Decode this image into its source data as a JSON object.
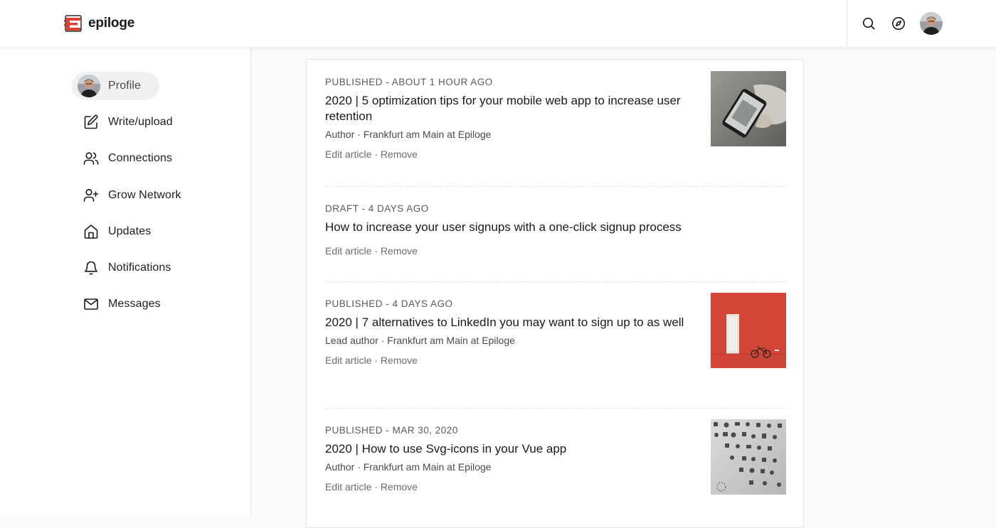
{
  "app": {
    "brand": "epiloge"
  },
  "topbar": {
    "icons": [
      "search-icon",
      "compass-icon"
    ]
  },
  "sidebar": {
    "items": [
      {
        "label": "Profile",
        "icon": "avatar"
      },
      {
        "label": "Write/upload",
        "icon": "edit-icon"
      },
      {
        "label": "Connections",
        "icon": "users-icon"
      },
      {
        "label": "Grow Network",
        "icon": "user-plus-icon"
      },
      {
        "label": "Updates",
        "icon": "home-icon"
      },
      {
        "label": "Notifications",
        "icon": "bell-icon"
      },
      {
        "label": "Messages",
        "icon": "mail-icon"
      }
    ]
  },
  "articles": [
    {
      "status": "PUBLISHED - ABOUT 1 HOUR AGO",
      "title": "2020 | 5 optimization tips for your mobile web app to increase user retention",
      "meta": "Author · Frankfurt am Main at Epiloge",
      "edit": "Edit article",
      "sep": " · ",
      "remove": "Remove",
      "thumb": "phone-photo"
    },
    {
      "status": "DRAFT - 4 DAYS AGO",
      "title": "How to increase your user signups with a one-click signup process",
      "meta": "",
      "edit": "Edit article",
      "sep": " · ",
      "remove": "Remove",
      "thumb": ""
    },
    {
      "status": "PUBLISHED - 4 DAYS AGO",
      "title": "2020 | 7 alternatives to LinkedIn you may want to sign up to as well",
      "meta": "Lead author · Frankfurt am Main at Epiloge",
      "edit": "Edit article",
      "sep": " · ",
      "remove": "Remove",
      "thumb": "red-wall-photo"
    },
    {
      "status": "PUBLISHED - MAR 30, 2020",
      "title": "2020 | How to use Svg-icons in your Vue app",
      "meta": "Author · Frankfurt am Main at Epiloge",
      "edit": "Edit article",
      "sep": " · ",
      "remove": "Remove",
      "thumb": "icons-photo"
    }
  ],
  "colors": {
    "brand_red": "#e0402f",
    "text": "#1a1a1a",
    "muted": "#6b6b6b"
  }
}
